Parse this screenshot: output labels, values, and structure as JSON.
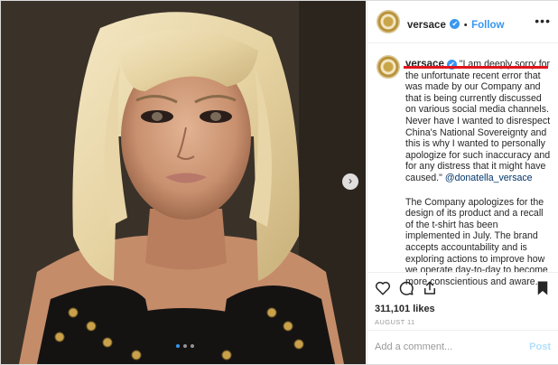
{
  "post": {
    "username": "versace",
    "verified_mark": "✔",
    "separator": "•",
    "follow_label": "Follow",
    "more_label": "•••"
  },
  "caption": {
    "username": "versace",
    "quote": "\"I am deeply sorry for the unfortunate recent error that was made by our Company and that is being currently discussed on various social media channels. Never have I wanted to disrespect China's National Sovereignty and this is why I wanted to personally apologize for such inaccuracy and for any distress that it might have caused.\"",
    "mention": "@donatella_versace",
    "statement": "The Company apologizes for the design of its product and a recall of the t-shirt has been implemented in July. The brand accepts accountability and is exploring actions to improve how we operate day-to-day to become more conscientious and aware."
  },
  "stats": {
    "likes": "311,101 likes",
    "date": "AUGUST 11"
  },
  "comment": {
    "placeholder": "Add a comment...",
    "post_label": "Post"
  },
  "carousel": {
    "next_label": "›"
  },
  "colors": {
    "accent": "#3897f0",
    "highlight": "#e0151e"
  },
  "icons": [
    "heart-icon",
    "comment-icon",
    "share-icon",
    "bookmark-icon",
    "chevron-right-icon"
  ]
}
